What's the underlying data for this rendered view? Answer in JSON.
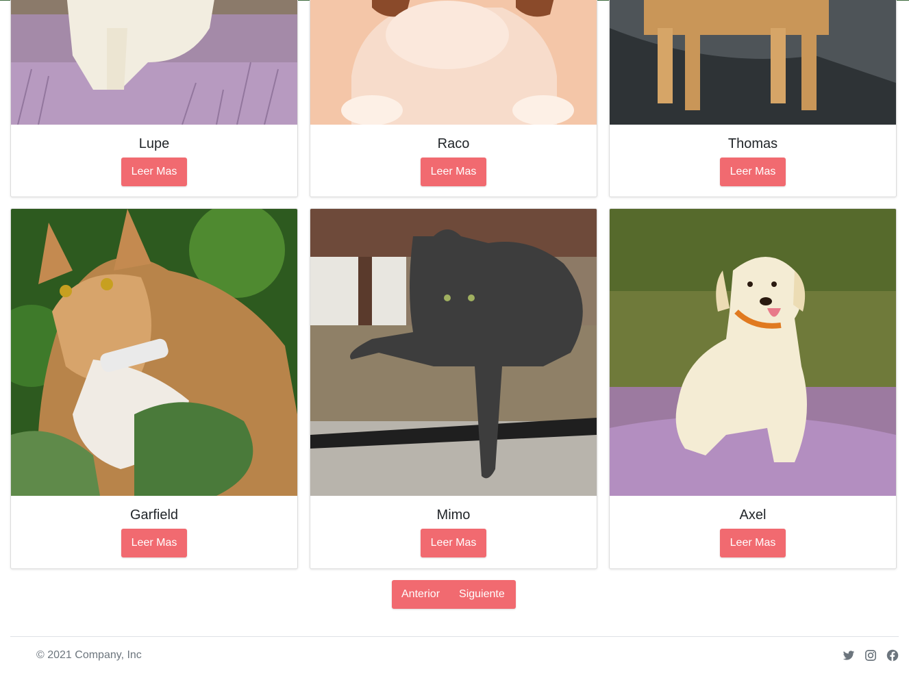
{
  "cards": [
    {
      "name": "Lupe",
      "button": "Leer Mas",
      "photo": "dog-in-heather"
    },
    {
      "name": "Raco",
      "button": "Leer Mas",
      "photo": "puppy-on-floor"
    },
    {
      "name": "Thomas",
      "button": "Leer Mas",
      "photo": "dog-on-pavement"
    },
    {
      "name": "Garfield",
      "button": "Leer Mas",
      "photo": "calico-cat"
    },
    {
      "name": "Mimo",
      "button": "Leer Mas",
      "photo": "gray-cat"
    },
    {
      "name": "Axel",
      "button": "Leer Mas",
      "photo": "labrador-in-heather"
    }
  ],
  "pagination": {
    "prev": "Anterior",
    "next": "Siguiente"
  },
  "footer": {
    "copyright": "© 2021 Company, Inc",
    "social": [
      "twitter-icon",
      "instagram-icon",
      "facebook-icon"
    ]
  },
  "colors": {
    "accent": "#f16a70",
    "muted": "#6c757d"
  }
}
